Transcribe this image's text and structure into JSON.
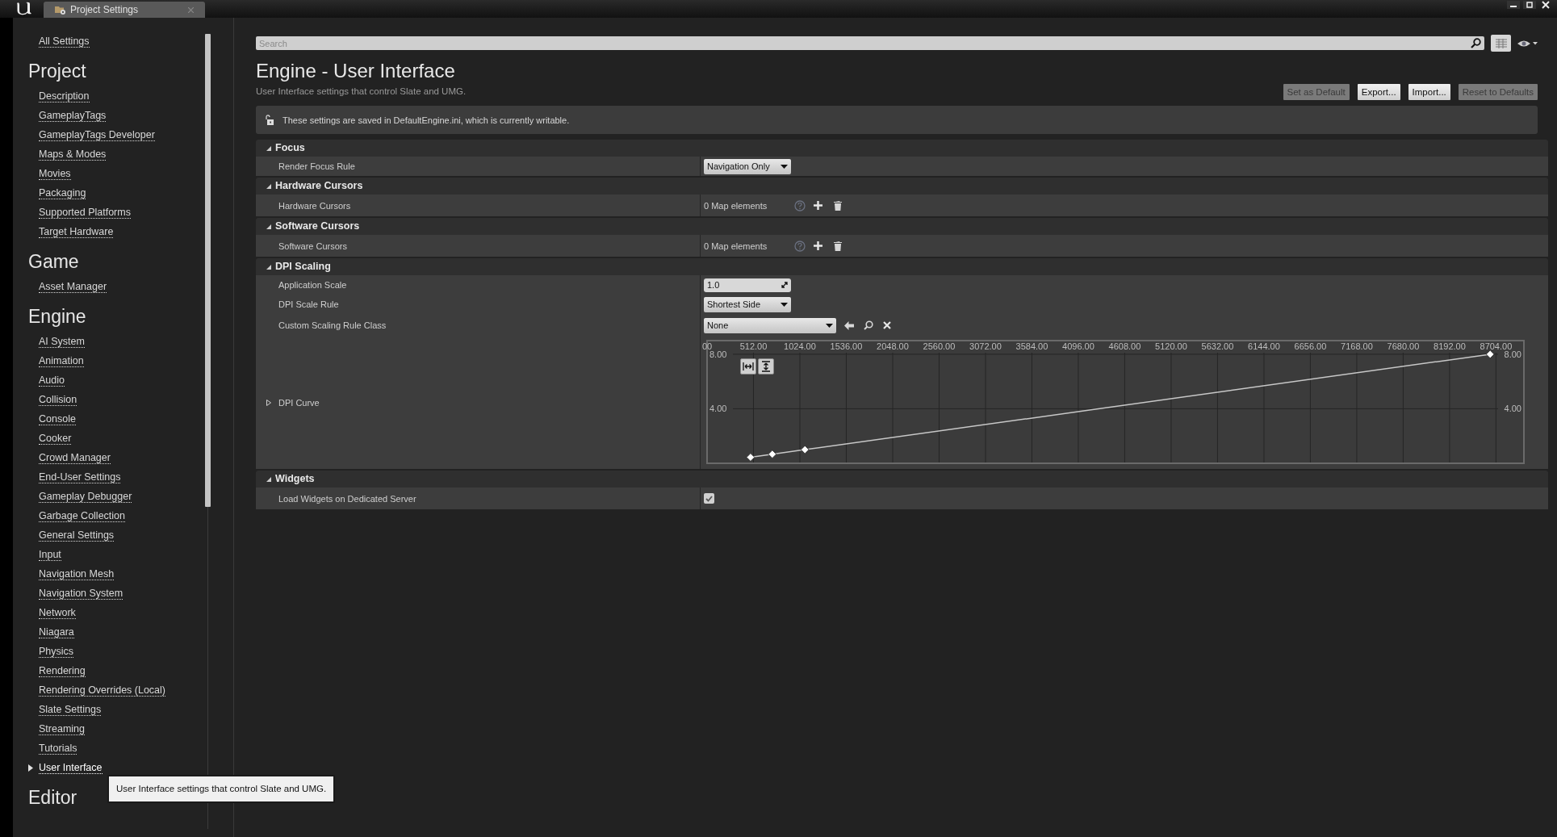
{
  "tab": {
    "title": "Project Settings"
  },
  "sidebar": {
    "top_link": "All Settings",
    "groups": [
      {
        "heading": "Project",
        "items": [
          {
            "label": "Description",
            "selected": false
          },
          {
            "label": "GameplayTags",
            "selected": false
          },
          {
            "label": "GameplayTags Developer",
            "selected": false
          },
          {
            "label": "Maps & Modes",
            "selected": false
          },
          {
            "label": "Movies",
            "selected": false
          },
          {
            "label": "Packaging",
            "selected": false
          },
          {
            "label": "Supported Platforms",
            "selected": false
          },
          {
            "label": "Target Hardware",
            "selected": false
          }
        ]
      },
      {
        "heading": "Game",
        "items": [
          {
            "label": "Asset Manager",
            "selected": false
          }
        ]
      },
      {
        "heading": "Engine",
        "items": [
          {
            "label": "AI System",
            "selected": false
          },
          {
            "label": "Animation",
            "selected": false
          },
          {
            "label": "Audio",
            "selected": false
          },
          {
            "label": "Collision",
            "selected": false
          },
          {
            "label": "Console",
            "selected": false
          },
          {
            "label": "Cooker",
            "selected": false
          },
          {
            "label": "Crowd Manager",
            "selected": false
          },
          {
            "label": "End-User Settings",
            "selected": false
          },
          {
            "label": "Gameplay Debugger",
            "selected": false
          },
          {
            "label": "Garbage Collection",
            "selected": false
          },
          {
            "label": "General Settings",
            "selected": false
          },
          {
            "label": "Input",
            "selected": false
          },
          {
            "label": "Navigation Mesh",
            "selected": false
          },
          {
            "label": "Navigation System",
            "selected": false
          },
          {
            "label": "Network",
            "selected": false
          },
          {
            "label": "Niagara",
            "selected": false
          },
          {
            "label": "Physics",
            "selected": false
          },
          {
            "label": "Rendering",
            "selected": false
          },
          {
            "label": "Rendering Overrides (Local)",
            "selected": false
          },
          {
            "label": "Slate Settings",
            "selected": false
          },
          {
            "label": "Streaming",
            "selected": false
          },
          {
            "label": "Tutorials",
            "selected": false
          },
          {
            "label": "User Interface",
            "selected": true
          }
        ]
      },
      {
        "heading": "Editor"
      }
    ]
  },
  "tooltip": {
    "text": "User Interface settings that control Slate and UMG."
  },
  "search": {
    "placeholder": "Search"
  },
  "header": {
    "title": "Engine - User Interface",
    "subtitle": "User Interface settings that control Slate and UMG."
  },
  "buttons": [
    {
      "label": "Set as Default",
      "disabled": true
    },
    {
      "label": "Export...",
      "disabled": false
    },
    {
      "label": "Import...",
      "disabled": false
    },
    {
      "label": "Reset to Defaults",
      "disabled": true
    }
  ],
  "notice": {
    "text": "These settings are saved in DefaultEngine.ini, which is currently writable."
  },
  "sections": [
    {
      "title": "Focus",
      "expanded": true,
      "rows": [
        {
          "kind": "dropdown",
          "label": "Render Focus Rule",
          "value": "Navigation Only"
        }
      ]
    },
    {
      "title": "Hardware Cursors",
      "expanded": true,
      "rows": [
        {
          "kind": "map",
          "label": "Hardware Cursors",
          "value": "0 Map elements"
        }
      ]
    },
    {
      "title": "Software Cursors",
      "expanded": true,
      "rows": [
        {
          "kind": "map",
          "label": "Software Cursors",
          "value": "0 Map elements"
        }
      ]
    },
    {
      "title": "DPI Scaling",
      "expanded": true,
      "rows": [
        {
          "kind": "number",
          "label": "Application Scale",
          "value": "1.0"
        },
        {
          "kind": "dropdown",
          "label": "DPI Scale Rule",
          "value": "Shortest Side"
        },
        {
          "kind": "class",
          "label": "Custom Scaling Rule Class",
          "value": "None"
        },
        {
          "kind": "curve",
          "label": "DPI Curve",
          "expanded": false,
          "chart_data": {
            "type": "line",
            "x": [
              480,
              720,
              1080,
              8640
            ],
            "grid": true,
            "series": [
              {
                "color": "#c8c8c8",
                "marker": "diamond",
                "values": [
                  0.44,
                  0.67,
                  1.0,
                  8.0
                ]
              }
            ],
            "xlim": [
              0,
              9012
            ],
            "ylim": [
              0,
              9
            ],
            "xticks": [
              {
                "value": 0,
                "label": "00"
              },
              {
                "value": 512,
                "label": "512.00"
              },
              {
                "value": 1024,
                "label": "1024.00"
              },
              {
                "value": 1536,
                "label": "1536.00"
              },
              {
                "value": 2048,
                "label": "2048.00"
              },
              {
                "value": 2560,
                "label": "2560.00"
              },
              {
                "value": 3072,
                "label": "3072.00"
              },
              {
                "value": 3584,
                "label": "3584.00"
              },
              {
                "value": 4096,
                "label": "4096.00"
              },
              {
                "value": 4608,
                "label": "4608.00"
              },
              {
                "value": 5120,
                "label": "5120.00"
              },
              {
                "value": 5632,
                "label": "5632.00"
              },
              {
                "value": 6144,
                "label": "6144.00"
              },
              {
                "value": 6656,
                "label": "6656.00"
              },
              {
                "value": 7168,
                "label": "7168.00"
              },
              {
                "value": 7680,
                "label": "7680.00"
              },
              {
                "value": 8192,
                "label": "8192.00"
              },
              {
                "value": 8704,
                "label": "8704.00"
              }
            ],
            "yticks": [
              {
                "value": 4,
                "label": "4.00"
              },
              {
                "value": 8,
                "label": "8.00"
              }
            ]
          }
        }
      ]
    },
    {
      "title": "Widgets",
      "expanded": true,
      "rows": [
        {
          "kind": "checkbox",
          "label": "Load Widgets on Dedicated Server",
          "checked": true
        }
      ]
    }
  ]
}
